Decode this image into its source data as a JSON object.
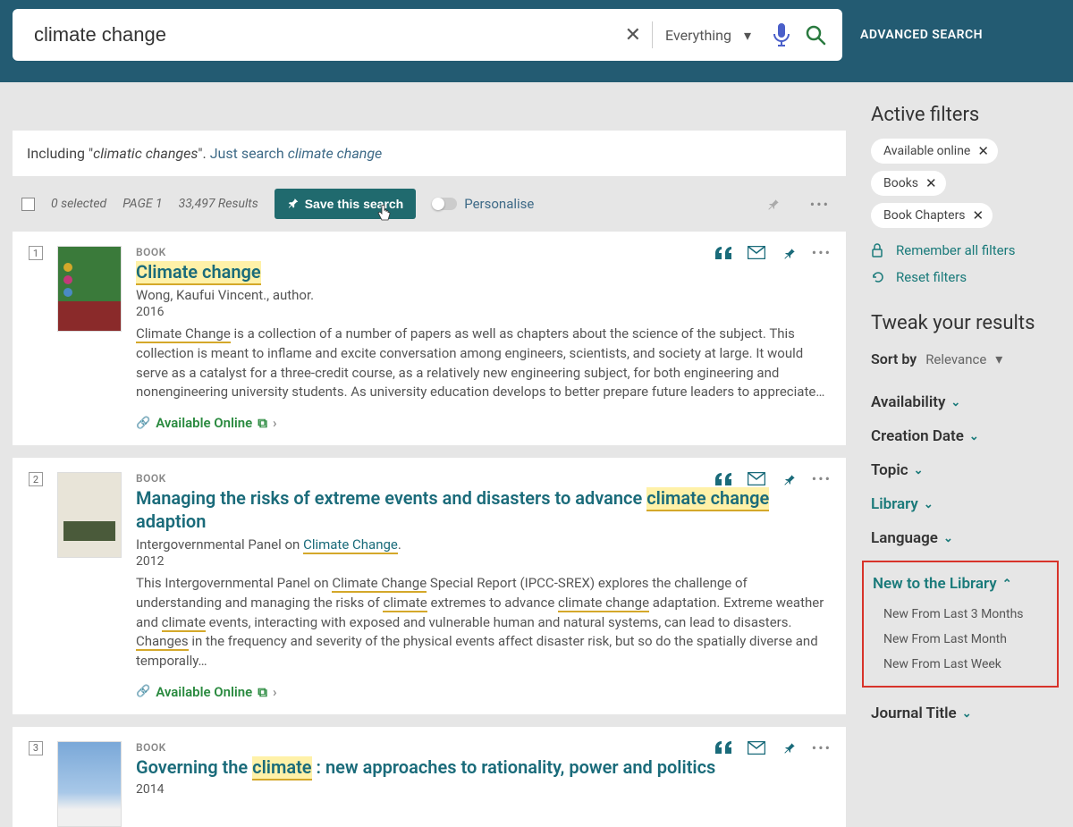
{
  "header": {
    "search_value": "climate change",
    "scope": "Everything",
    "advanced": "ADVANCED SEARCH"
  },
  "expansion": {
    "prefix": "Including \"",
    "term": "climatic changes",
    "suffix": "\". ",
    "link_label": "Just search ",
    "link_term": "climate change"
  },
  "toolbar": {
    "selected": "0 selected",
    "page": "PAGE 1",
    "count": "33,497 Results",
    "save_search": "Save this search",
    "personalise": "Personalise"
  },
  "results": [
    {
      "num": "1",
      "type": "BOOK",
      "title_pre": "",
      "title_hl": "Climate change",
      "title_post": "",
      "author": "Wong, Kaufui Vincent., author.",
      "year": "2016",
      "desc_html": "<span class='hl'>Climate Change</span> is a collection of a number of papers as well as chapters about the science of the subject. This collection is meant to inflame and excite conversation among engineers, scientists, and society at large. It would serve as a catalyst for a three-credit course, as a relatively new engineering subject, for both engineering and nonengineering university students. As university education develops to better prepare future leaders to appreciate…",
      "avail": "Available Online"
    },
    {
      "num": "2",
      "type": "BOOK",
      "title_html": "Managing the risks of extreme events and disasters to advance <span class='hl'>climate change</span> adaption",
      "author_html": "Intergovernmental Panel on <span class='hl-link'>Climate Change</span>.",
      "year": "2012",
      "desc_html": "This Intergovernmental Panel on <span class='hl'>Climate Change</span> Special Report (IPCC-SREX) explores the challenge of understanding and managing the risks of <span class='hl'>climate</span> extremes to advance <span class='hl'>climate change</span> adaptation. Extreme weather and <span class='hl'>climate</span> events, interacting with exposed and vulnerable human and natural systems, can lead to disasters. <span class='hl'>Changes</span> in the frequency and severity of the physical events affect disaster risk, but so do the spatially diverse and temporally…",
      "avail": "Available Online"
    },
    {
      "num": "3",
      "type": "BOOK",
      "title_html": "Governing the <span class='hl'>climate</span> : new approaches to rationality, power and politics",
      "year": "2014"
    }
  ],
  "sidebar": {
    "active_filters": "Active filters",
    "chips": [
      "Available online",
      "Books",
      "Book Chapters"
    ],
    "remember": "Remember all filters",
    "reset": "Reset filters",
    "tweak": "Tweak your results",
    "sort_label": "Sort by",
    "sort_value": "Relevance",
    "facets": {
      "availability": "Availability",
      "creation_date": "Creation Date",
      "topic": "Topic",
      "library": "Library",
      "language": "Language",
      "new_to_library": "New to the Library",
      "journal_title": "Journal Title"
    },
    "new_items": [
      "New From Last 3 Months",
      "New From Last Month",
      "New From Last Week"
    ]
  }
}
